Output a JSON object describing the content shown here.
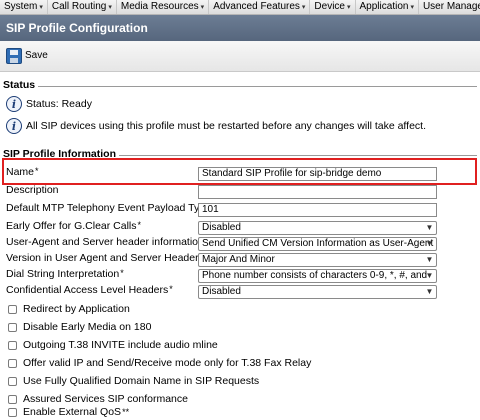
{
  "menu": [
    "System",
    "Call Routing",
    "Media Resources",
    "Advanced Features",
    "Device",
    "Application",
    "User Management"
  ],
  "title": "SIP Profile Configuration",
  "toolbar": {
    "save_label": "Save"
  },
  "status": {
    "legend": "Status",
    "ready": "Status: Ready",
    "notice": "All SIP devices using this profile must be restarted before any changes will take affect."
  },
  "info": {
    "legend": "SIP Profile Information",
    "name_label": "Name",
    "name_value": "Standard SIP Profile for sip-bridge demo",
    "description_label": "Description",
    "description_value": "",
    "mtp_label": "Default MTP Telephony Event Payload Type",
    "mtp_value": "101",
    "early_offer_label": "Early Offer for G.Clear Calls",
    "early_offer_value": "Disabled",
    "ua_label": "User-Agent and Server header information",
    "ua_value": "Send Unified CM Version Information as User-Agent",
    "version_label": "Version in User Agent and Server Header",
    "version_value": "Major And Minor",
    "dial_label": "Dial String Interpretation",
    "dial_value": "Phone number consists of characters 0-9, *, #, and",
    "cal_label": "Confidential Access Level Headers",
    "cal_value": "Disabled"
  },
  "checkboxes": [
    "Redirect by Application",
    "Disable Early Media on 180",
    "Outgoing T.38 INVITE include audio mline",
    "Offer valid IP and Send/Receive mode only for T.38 Fax Relay",
    "Use Fully Qualified Domain Name in SIP Requests",
    "Assured Services SIP conformance",
    "Enable External QoS"
  ],
  "required_mark": "*",
  "double_mark": "**",
  "icons": {
    "dropdown": "chevron-down-icon",
    "info": "info-icon",
    "save": "save-icon"
  }
}
